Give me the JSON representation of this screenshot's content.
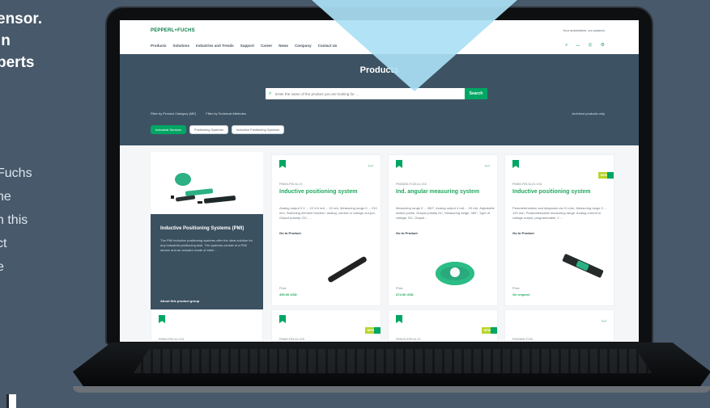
{
  "left_copy": {
    "headline_lines": [
      "ensor.",
      "in",
      "perts"
    ],
    "body_lines": [
      "Fuchs",
      "he",
      "n this",
      "ct",
      "e"
    ]
  },
  "site": {
    "logo": "PEPPERL+FUCHS",
    "tagline": "Your automation, our passion.",
    "nav": [
      "Products",
      "Solutions",
      "Industries and Trends",
      "Support",
      "Career",
      "News",
      "Company",
      "Contact Us"
    ],
    "icons": [
      "search-icon",
      "cart-icon",
      "profile-icon",
      "settings-icon"
    ]
  },
  "hero": {
    "title": "Products",
    "search_placeholder": "Enter the name of the product you are looking for ...",
    "search_button": "Search",
    "filters": [
      "Filter by Product Category (ME)",
      "Filter by Technical Attributes"
    ],
    "lock_label": "Archived products only",
    "chips": [
      "Industrial Sensors",
      "Positioning Systems",
      "Inductive Positioning Systems"
    ]
  },
  "group": {
    "title": "Inductive Positioning Systems (PMI)",
    "copy": "The PMI inductive positioning systems offer the ideal solution for any industrial positioning task. The systems consist of a PMI sensor and an actuator made of steel ...",
    "link": "About this product group"
  },
  "cards": [
    {
      "category": "PMI40-F90-IU-V1",
      "title": "Inductive positioning system",
      "desc": "Analog output 0 V ... 10 V/4 mA ... 20 mA, Measuring range 0 ... 210 mm, Switching element function: analog, current or voltage out-put, Output polarity: DC, ...",
      "link": "Go to Product",
      "price_label": "Price",
      "price": "490.00 USD",
      "badge": ""
    },
    {
      "category": "PMI360D-F130-IU-V15",
      "title": "Ind. angular measuring system",
      "desc": "Measuring range 0 ... 360°, Analog output 4 mA ... 20 mA, Adjustable switch points, Output polarity DC, Measuring range: 360°, Type of voltage: DC, Output ...",
      "link": "Go to Product",
      "price_label": "Price",
      "price": "374.00 USD",
      "badge": ""
    },
    {
      "category": "PMI80-F95-IU-IO-V15",
      "title": "Inductive positioning system",
      "desc": "Parameterization and diagnosis via IO-Link, Measuring range 0 ... 120 mm, Parameterizable measuring range, Analog current or voltage output, programmable, 2 ...",
      "link": "Go to Product",
      "price_label": "Price",
      "price": "On request",
      "badge": "NEW"
    }
  ],
  "lower_cards": [
    {
      "category": "PMI40-F90-IU-V15",
      "badge": ""
    },
    {
      "category": "PMI80-F95-IU-V15",
      "badge": "NEW"
    },
    {
      "category": "PMI120-F90-IU-V1",
      "badge": "NEW"
    },
    {
      "category": "PMI360D-F130",
      "badge": ""
    }
  ]
}
